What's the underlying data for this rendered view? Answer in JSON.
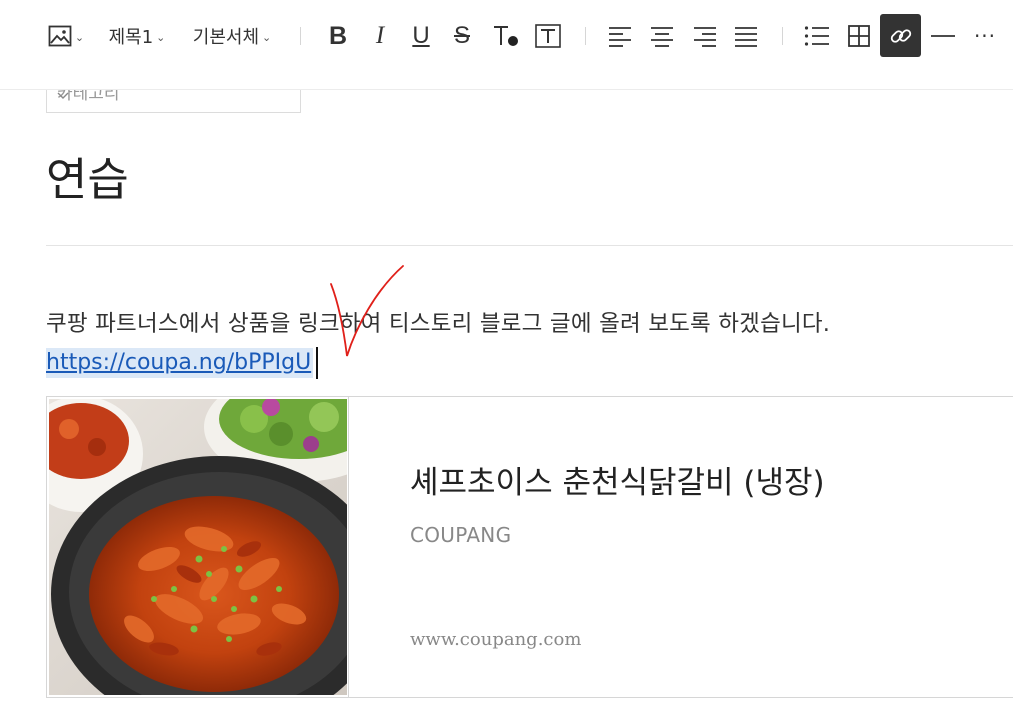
{
  "toolbar": {
    "image_icon": "image-icon",
    "heading_label": "제목1",
    "font_label": "기본서체",
    "buttons": [
      "bold",
      "italic",
      "underline",
      "strikethrough",
      "text-color",
      "text-background",
      "align-left",
      "align-center",
      "align-right",
      "align-justify",
      "bulleted-list",
      "table",
      "link",
      "horizontal-line",
      "more"
    ],
    "active_button": "link",
    "bold_glyph": "B",
    "italic_glyph": "I",
    "underline_glyph": "U",
    "strike_glyph": "S",
    "more_glyph": "···"
  },
  "editor": {
    "category_placeholder": "카테고리",
    "title": "연습",
    "paragraph": "쿠팡 파트너스에서 상품을 링크하여 티스토리 블로그 글에 올려 보도록 하겠습니다.",
    "link_text": "https://coupa.ng/bPPIgU"
  },
  "link_card": {
    "title": "셰프초이스 춘천식닭갈비 (냉장)",
    "source": "COUPANG",
    "url": "www.coupang.com",
    "image": "spicy-stir-fried-chicken-photo"
  },
  "colors": {
    "link": "#1a5ab8",
    "link_highlight": "#dbe8f7",
    "active_button_bg": "#333333",
    "annotation": "#e0201a"
  }
}
